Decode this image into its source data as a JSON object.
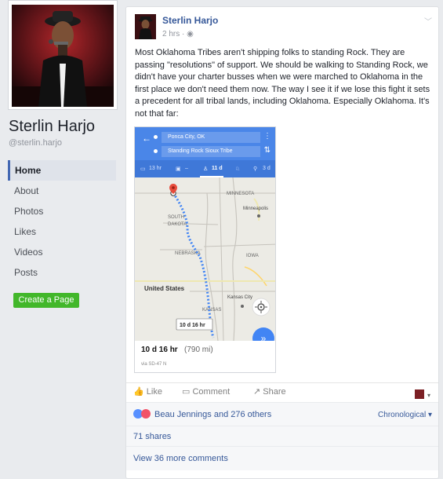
{
  "profile": {
    "name": "Sterlin Harjo",
    "handle": "@sterlin.harjo"
  },
  "nav": {
    "items": [
      {
        "label": "Home",
        "active": true
      },
      {
        "label": "About"
      },
      {
        "label": "Photos"
      },
      {
        "label": "Likes"
      },
      {
        "label": "Videos"
      },
      {
        "label": "Posts"
      }
    ],
    "create_page_label": "Create a Page"
  },
  "post": {
    "author": "Sterlin Harjo",
    "time": "2 hrs",
    "privacy_icon": "globe-icon",
    "text": "Most Oklahoma Tribes aren't shipping folks to standing Rock. They are passing \"resolutions\" of support. We should be walking to Standing Rock, we didn't have your charter busses when we were marched to Oklahoma in the first place we don't need them now. The way I see it if we lose this fight it sets a precedent for all tribal lands, including Oklahoma. Especially Oklahoma. It's not that far:",
    "map": {
      "origin": "Ponca City, OK",
      "destination": "Standing Rock Sioux Tribe",
      "modes": {
        "drive": "13 hr",
        "transit": "–",
        "walk": "11 d",
        "bike": "3 d"
      },
      "route_label": "10 d 16 hr",
      "summary_time": "10 d 16 hr",
      "summary_distance": "(790 mi)",
      "via": "via SD-47 N",
      "labels": {
        "minnesota": "MINNESOTA",
        "minneapolis": "Minneapolis",
        "south_dakota": "SOUTH\nDAKOTA",
        "nebraska": "NEBRASKA",
        "iowa": "IOWA",
        "united_states": "United States",
        "kansas_city": "Kansas City",
        "kansas": "KANSAS"
      }
    },
    "actions": {
      "like": "Like",
      "comment": "Comment",
      "share": "Share"
    },
    "reactions_text": "Beau Jennings and 276 others",
    "ordering": "Chronological",
    "shares": "71 shares",
    "more_comments": "View 36 more comments"
  },
  "colors": {
    "facebook_blue": "#4267b2",
    "link_blue": "#365899",
    "map_blue": "#4a86e8",
    "create_green": "#42b72a"
  }
}
